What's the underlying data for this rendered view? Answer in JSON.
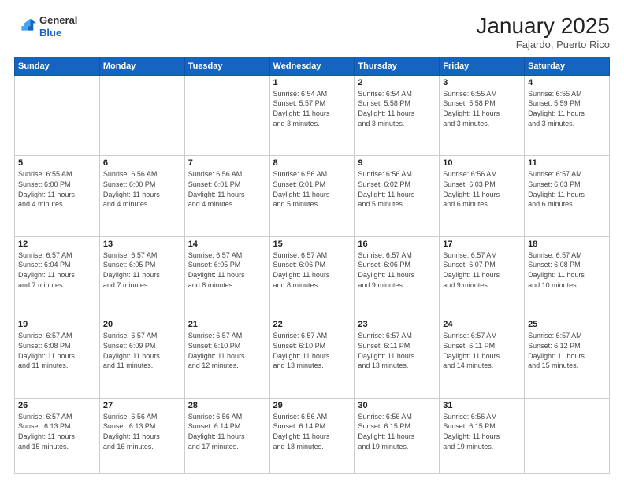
{
  "header": {
    "logo_general": "General",
    "logo_blue": "Blue",
    "calendar_title": "January 2025",
    "calendar_subtitle": "Fajardo, Puerto Rico"
  },
  "weekdays": [
    "Sunday",
    "Monday",
    "Tuesday",
    "Wednesday",
    "Thursday",
    "Friday",
    "Saturday"
  ],
  "weeks": [
    {
      "days": [
        {
          "number": "",
          "info": ""
        },
        {
          "number": "",
          "info": ""
        },
        {
          "number": "",
          "info": ""
        },
        {
          "number": "1",
          "info": "Sunrise: 6:54 AM\nSunset: 5:57 PM\nDaylight: 11 hours\nand 3 minutes."
        },
        {
          "number": "2",
          "info": "Sunrise: 6:54 AM\nSunset: 5:58 PM\nDaylight: 11 hours\nand 3 minutes."
        },
        {
          "number": "3",
          "info": "Sunrise: 6:55 AM\nSunset: 5:58 PM\nDaylight: 11 hours\nand 3 minutes."
        },
        {
          "number": "4",
          "info": "Sunrise: 6:55 AM\nSunset: 5:59 PM\nDaylight: 11 hours\nand 3 minutes."
        }
      ]
    },
    {
      "days": [
        {
          "number": "5",
          "info": "Sunrise: 6:55 AM\nSunset: 6:00 PM\nDaylight: 11 hours\nand 4 minutes."
        },
        {
          "number": "6",
          "info": "Sunrise: 6:56 AM\nSunset: 6:00 PM\nDaylight: 11 hours\nand 4 minutes."
        },
        {
          "number": "7",
          "info": "Sunrise: 6:56 AM\nSunset: 6:01 PM\nDaylight: 11 hours\nand 4 minutes."
        },
        {
          "number": "8",
          "info": "Sunrise: 6:56 AM\nSunset: 6:01 PM\nDaylight: 11 hours\nand 5 minutes."
        },
        {
          "number": "9",
          "info": "Sunrise: 6:56 AM\nSunset: 6:02 PM\nDaylight: 11 hours\nand 5 minutes."
        },
        {
          "number": "10",
          "info": "Sunrise: 6:56 AM\nSunset: 6:03 PM\nDaylight: 11 hours\nand 6 minutes."
        },
        {
          "number": "11",
          "info": "Sunrise: 6:57 AM\nSunset: 6:03 PM\nDaylight: 11 hours\nand 6 minutes."
        }
      ]
    },
    {
      "days": [
        {
          "number": "12",
          "info": "Sunrise: 6:57 AM\nSunset: 6:04 PM\nDaylight: 11 hours\nand 7 minutes."
        },
        {
          "number": "13",
          "info": "Sunrise: 6:57 AM\nSunset: 6:05 PM\nDaylight: 11 hours\nand 7 minutes."
        },
        {
          "number": "14",
          "info": "Sunrise: 6:57 AM\nSunset: 6:05 PM\nDaylight: 11 hours\nand 8 minutes."
        },
        {
          "number": "15",
          "info": "Sunrise: 6:57 AM\nSunset: 6:06 PM\nDaylight: 11 hours\nand 8 minutes."
        },
        {
          "number": "16",
          "info": "Sunrise: 6:57 AM\nSunset: 6:06 PM\nDaylight: 11 hours\nand 9 minutes."
        },
        {
          "number": "17",
          "info": "Sunrise: 6:57 AM\nSunset: 6:07 PM\nDaylight: 11 hours\nand 9 minutes."
        },
        {
          "number": "18",
          "info": "Sunrise: 6:57 AM\nSunset: 6:08 PM\nDaylight: 11 hours\nand 10 minutes."
        }
      ]
    },
    {
      "days": [
        {
          "number": "19",
          "info": "Sunrise: 6:57 AM\nSunset: 6:08 PM\nDaylight: 11 hours\nand 11 minutes."
        },
        {
          "number": "20",
          "info": "Sunrise: 6:57 AM\nSunset: 6:09 PM\nDaylight: 11 hours\nand 11 minutes."
        },
        {
          "number": "21",
          "info": "Sunrise: 6:57 AM\nSunset: 6:10 PM\nDaylight: 11 hours\nand 12 minutes."
        },
        {
          "number": "22",
          "info": "Sunrise: 6:57 AM\nSunset: 6:10 PM\nDaylight: 11 hours\nand 13 minutes."
        },
        {
          "number": "23",
          "info": "Sunrise: 6:57 AM\nSunset: 6:11 PM\nDaylight: 11 hours\nand 13 minutes."
        },
        {
          "number": "24",
          "info": "Sunrise: 6:57 AM\nSunset: 6:11 PM\nDaylight: 11 hours\nand 14 minutes."
        },
        {
          "number": "25",
          "info": "Sunrise: 6:57 AM\nSunset: 6:12 PM\nDaylight: 11 hours\nand 15 minutes."
        }
      ]
    },
    {
      "days": [
        {
          "number": "26",
          "info": "Sunrise: 6:57 AM\nSunset: 6:13 PM\nDaylight: 11 hours\nand 15 minutes."
        },
        {
          "number": "27",
          "info": "Sunrise: 6:56 AM\nSunset: 6:13 PM\nDaylight: 11 hours\nand 16 minutes."
        },
        {
          "number": "28",
          "info": "Sunrise: 6:56 AM\nSunset: 6:14 PM\nDaylight: 11 hours\nand 17 minutes."
        },
        {
          "number": "29",
          "info": "Sunrise: 6:56 AM\nSunset: 6:14 PM\nDaylight: 11 hours\nand 18 minutes."
        },
        {
          "number": "30",
          "info": "Sunrise: 6:56 AM\nSunset: 6:15 PM\nDaylight: 11 hours\nand 19 minutes."
        },
        {
          "number": "31",
          "info": "Sunrise: 6:56 AM\nSunset: 6:15 PM\nDaylight: 11 hours\nand 19 minutes."
        },
        {
          "number": "",
          "info": ""
        }
      ]
    }
  ]
}
